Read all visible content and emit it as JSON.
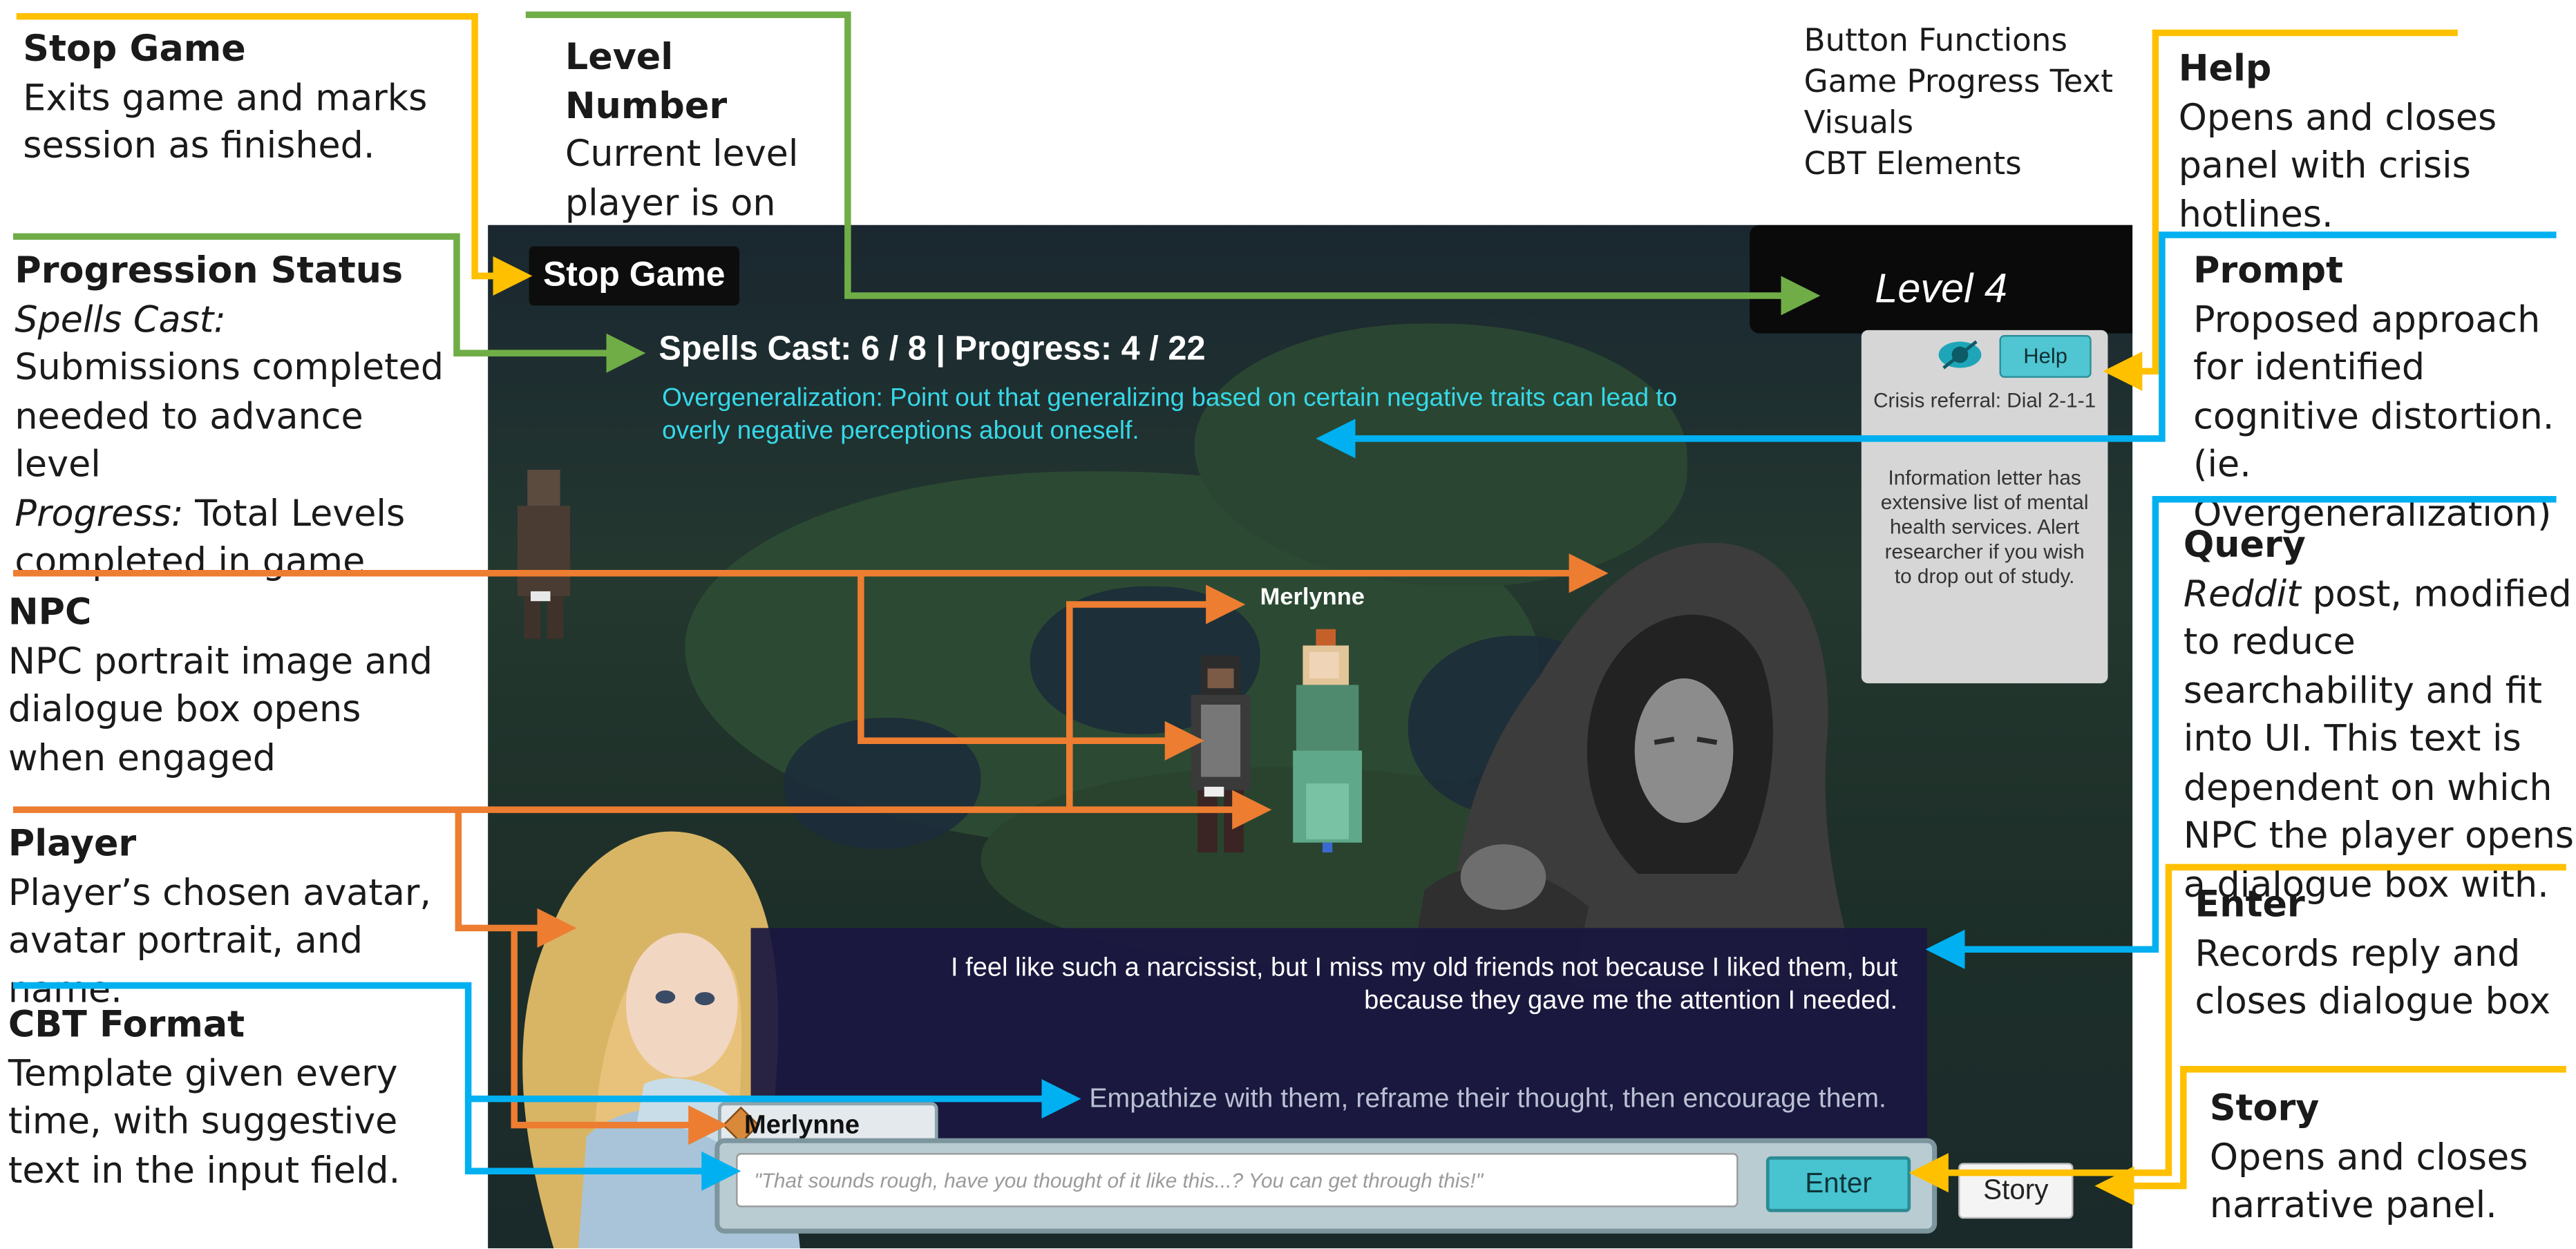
{
  "legend": [
    "Button Functions",
    "Game Progress Text",
    "Visuals",
    "CBT Elements"
  ],
  "colors": {
    "button_functions": "#FFC000",
    "game_progress_text": "#70AD47",
    "visuals": "#ED7D31",
    "cbt_elements": "#00B0F0"
  },
  "annotations": {
    "stop_game": {
      "title": "Stop Game",
      "desc": "Exits game and marks session as finished."
    },
    "level_number": {
      "title": "Level Number",
      "desc": "Current level player is on"
    },
    "progression": {
      "title": "Progression Status",
      "spells_label": "Spells Cast:",
      "spells_desc": " Submissions completed needed to advance level",
      "progress_label": "Progress:",
      "progress_desc": " Total Levels completed in game"
    },
    "npc": {
      "title": "NPC",
      "desc": "NPC portrait image and dialogue box opens when engaged"
    },
    "player": {
      "title": "Player",
      "desc": "Player’s chosen avatar, avatar portrait, and name."
    },
    "cbt_format": {
      "title": "CBT Format",
      "desc": "Template given every time, with suggestive text in the input field."
    },
    "help": {
      "title": "Help",
      "desc": "Opens and closes panel with crisis hotlines."
    },
    "prompt": {
      "title": "Prompt",
      "desc": "Proposed approach for identified cognitive distortion. (ie. Overgeneralization)"
    },
    "query": {
      "title": "Query",
      "reddit": "Reddit",
      "desc": " post, modified to reduce searchability and fit into UI. This text is dependent on which NPC the player opens a dialogue box with."
    },
    "enter": {
      "title": "Enter",
      "desc": "Records reply and closes dialogue box"
    },
    "story": {
      "title": "Story",
      "desc": "Opens and closes narrative panel."
    }
  },
  "game": {
    "stop_button": "Stop Game",
    "level": "Level 4",
    "status": "Spells Cast: 6 / 8 | Progress: 4 / 22",
    "prompt": "Overgeneralization: Point out that generalizing based on certain negative traits can lead to overly negative perceptions about oneself.",
    "help_button": "Help",
    "crisis": "Crisis referral: Dial 2-1-1",
    "info": "Information letter has extensive list of mental health services. Alert researcher if you wish to drop out of study.",
    "npc_name": "Merlynne",
    "query": "I feel like such a narcissist, but I miss my old friends not because I liked them, but because they gave me the attention I needed.",
    "cbt_template": "Empathize with them, reframe their thought, then encourage them.",
    "player_name": "Merlynne",
    "input_placeholder": "\"That sounds rough, have you thought of it like this...? You can get through this!\"",
    "enter_button": "Enter",
    "story_button": "Story"
  }
}
